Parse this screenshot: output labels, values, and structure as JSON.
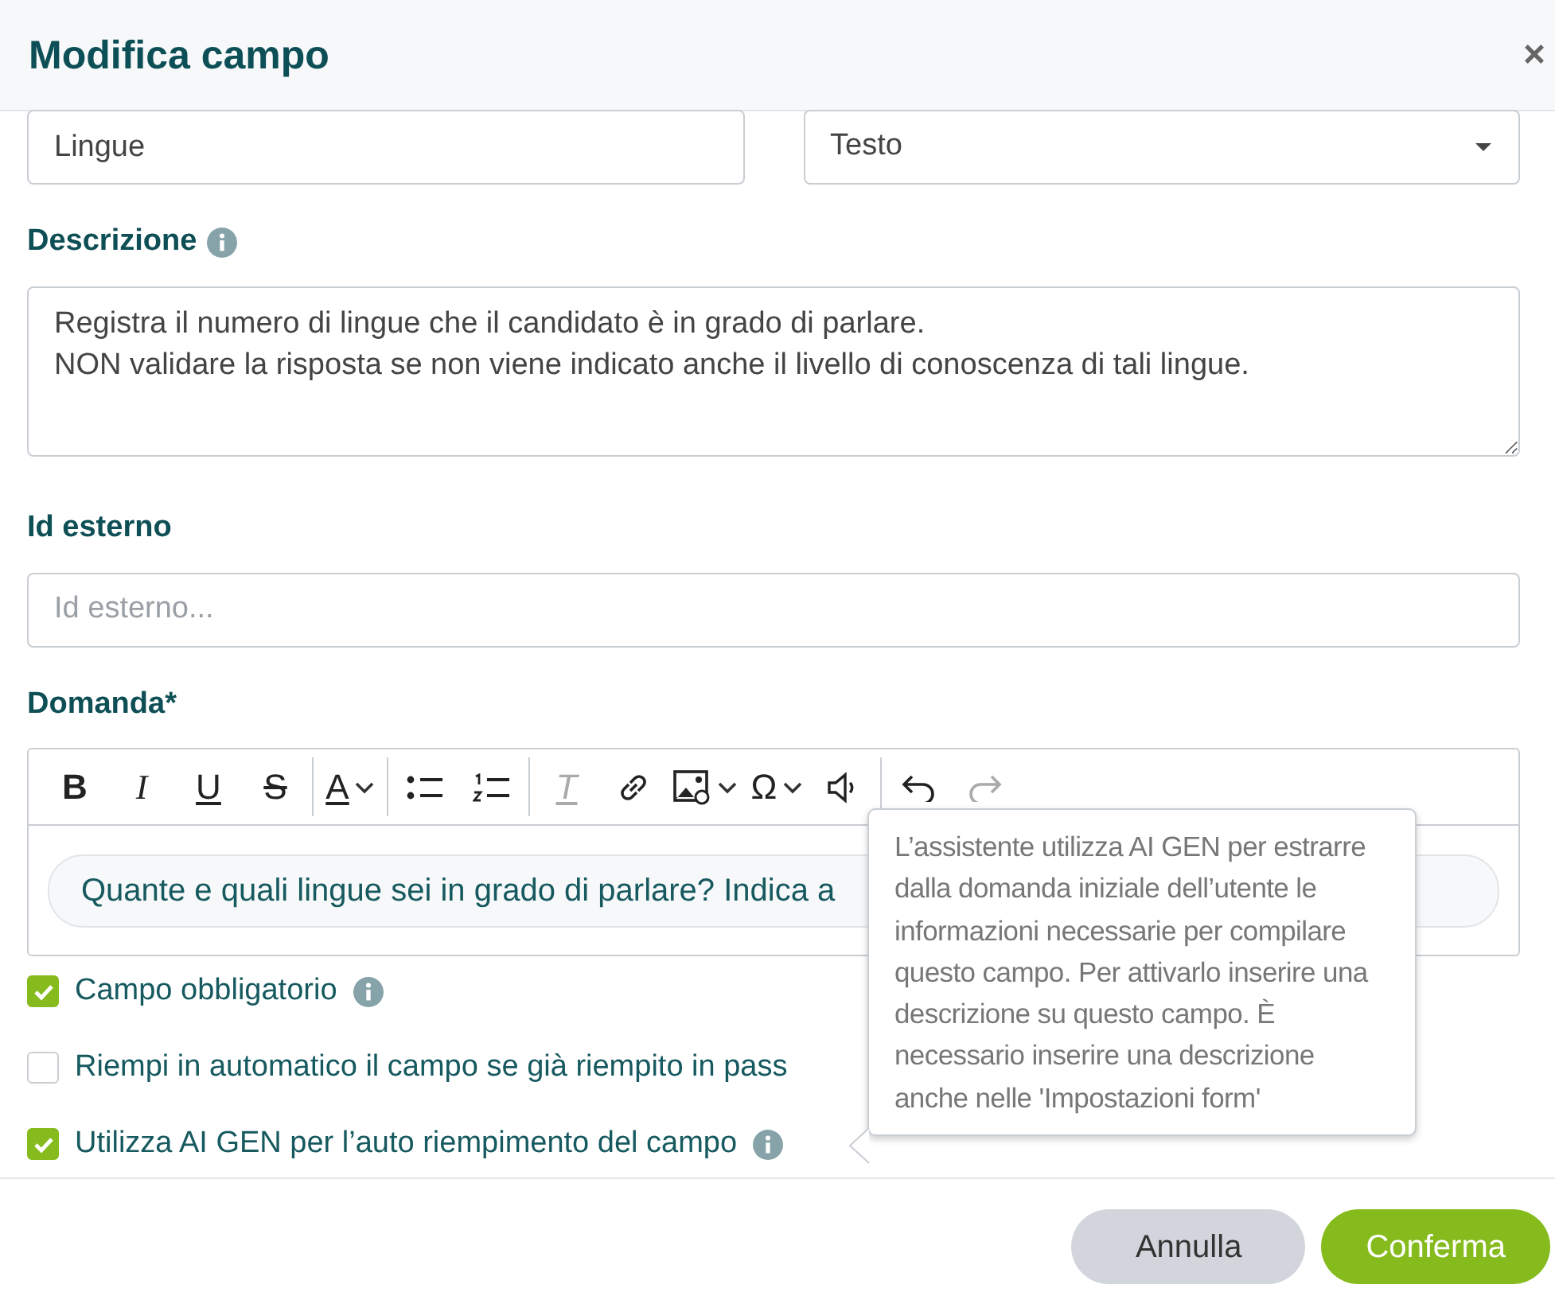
{
  "dialog": {
    "title": "Modifica campo",
    "close": "×"
  },
  "name_field": {
    "value": "Lingue"
  },
  "type_select": {
    "value": "Testo"
  },
  "description": {
    "label": "Descrizione",
    "value": "Registra il numero di lingue che il candidato è in grado di parlare.\nNON validare la risposta se non viene indicato anche il livello di conoscenza di tali lingue."
  },
  "external_id": {
    "label": "Id esterno",
    "placeholder": "Id esterno..."
  },
  "question": {
    "label": "Domanda*",
    "toolbar": [
      [
        {
          "kind": "bold",
          "label": "B",
          "disabled": false
        },
        {
          "kind": "italic",
          "label": "I",
          "disabled": false
        },
        {
          "kind": "underline",
          "label": "U",
          "disabled": false
        },
        {
          "kind": "strike",
          "label": "S",
          "disabled": false
        }
      ],
      [
        {
          "kind": "font-color",
          "label": "A",
          "disabled": false,
          "dropdown": true
        }
      ],
      [
        {
          "kind": "bullets",
          "disabled": false
        },
        {
          "kind": "numbers",
          "disabled": false
        }
      ],
      [
        {
          "kind": "clear-format",
          "label": "T",
          "disabled": true
        },
        {
          "kind": "link",
          "disabled": false
        },
        {
          "kind": "image",
          "disabled": false,
          "dropdown": true
        },
        {
          "kind": "special-char",
          "label": "Ω",
          "disabled": false,
          "dropdown": true
        },
        {
          "kind": "speaker",
          "disabled": false
        }
      ],
      [
        {
          "kind": "undo",
          "disabled": false
        },
        {
          "kind": "redo",
          "disabled": true
        }
      ]
    ],
    "value": "Quante e quali lingue sei in grado di parlare? Indica a"
  },
  "options": [
    {
      "label": "Campo obbligatorio",
      "checked": true,
      "info": true
    },
    {
      "label": "Riempi in automatico il campo se già riempito in pass",
      "checked": false,
      "info": false
    },
    {
      "label": "Utilizza AI GEN per l’auto riempimento del campo",
      "checked": true,
      "info": true
    }
  ],
  "tooltip": {
    "text": "L’assistente utilizza AI GEN per estrarre dalla domanda iniziale dell’utente le informazioni necessarie per compilare questo campo. Per attivarlo inserire una descrizione su questo campo. È necessario inserire una descrizione anche nelle 'Impostazioni form'"
  },
  "buttons": [
    {
      "label": "Annulla",
      "kind": "secondary"
    },
    {
      "label": "Conferma",
      "kind": "primary"
    }
  ]
}
